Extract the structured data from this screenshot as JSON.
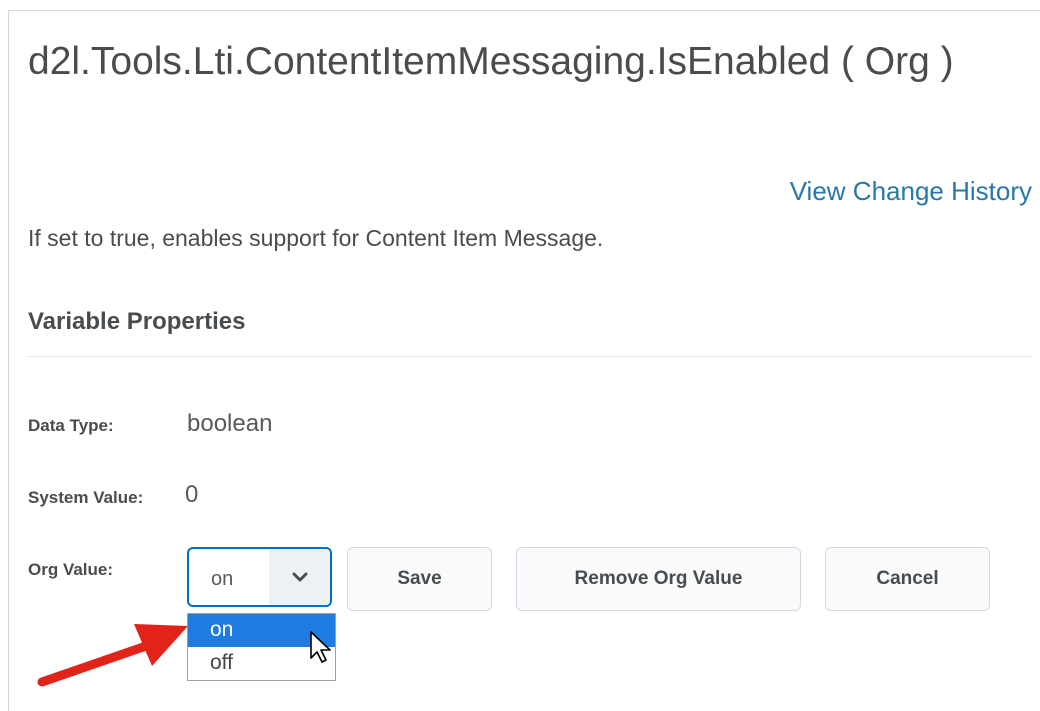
{
  "page": {
    "title": "d2l.Tools.Lti.ContentItemMessaging.IsEnabled ( Org )",
    "history_link": "View Change History",
    "description": "If set to true, enables support for Content Item Message."
  },
  "properties": {
    "heading": "Variable Properties",
    "data_type_label": "Data Type:",
    "data_type_value": "boolean",
    "system_value_label": "System Value:",
    "system_value_value": "0",
    "org_value_label": "Org Value:"
  },
  "org_select": {
    "selected": "on",
    "options": [
      "on",
      "off"
    ],
    "highlighted_option": "on"
  },
  "buttons": {
    "save": "Save",
    "remove": "Remove Org Value",
    "cancel": "Cancel"
  },
  "colors": {
    "link": "#2877a6",
    "focus": "#006fbf",
    "highlight": "#1e7be0",
    "annotation_arrow": "#e2231a"
  },
  "icons": {
    "select_arrow": "chevron-down-icon",
    "cursor": "mouse-pointer-icon",
    "annotation": "red-arrow-annotation"
  }
}
